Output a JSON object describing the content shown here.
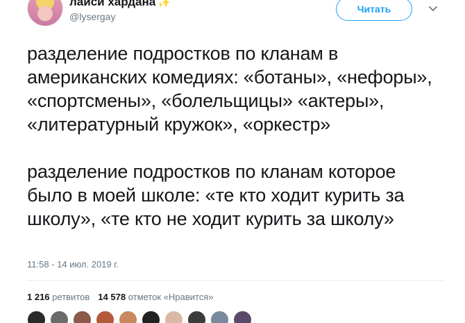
{
  "header": {
    "display_name": "лайси хардана",
    "sparkle": "✨",
    "handle": "@lysergay",
    "follow_label": "Читать",
    "more_icon": "chevron-down-icon"
  },
  "tweet": {
    "paragraphs": [
      "разделение подростков по кланам в американских комедиях: «ботаны», «нефоры», «спортсмены», «болельщицы» «актеры», «литературный кружок», «оркестр»",
      "разделение подростков по кланам которое было в моей школе: «те кто ходит курить за школу», «те кто не ходит курить за школу»"
    ],
    "timestamp": "11:58 - 14 июл. 2019 г."
  },
  "stats": {
    "retweets_count": "1 216",
    "retweets_label": "ретвитов",
    "likes_count": "14 578",
    "likes_label": "отметок «Нравится»"
  },
  "likers": [
    {
      "color": "#2b2b2b"
    },
    {
      "color": "#6b6b6b"
    },
    {
      "color": "#8a5a4a"
    },
    {
      "color": "#b35a3a"
    },
    {
      "color": "#c9885f"
    },
    {
      "color": "#222222"
    },
    {
      "color": "#d9b9a6"
    },
    {
      "color": "#3c3c3c"
    },
    {
      "color": "#7a8a9c"
    },
    {
      "color": "#5b4b6b"
    }
  ],
  "colors": {
    "accent": "#1da1f2",
    "text": "#14171a",
    "secondary": "#657786"
  }
}
